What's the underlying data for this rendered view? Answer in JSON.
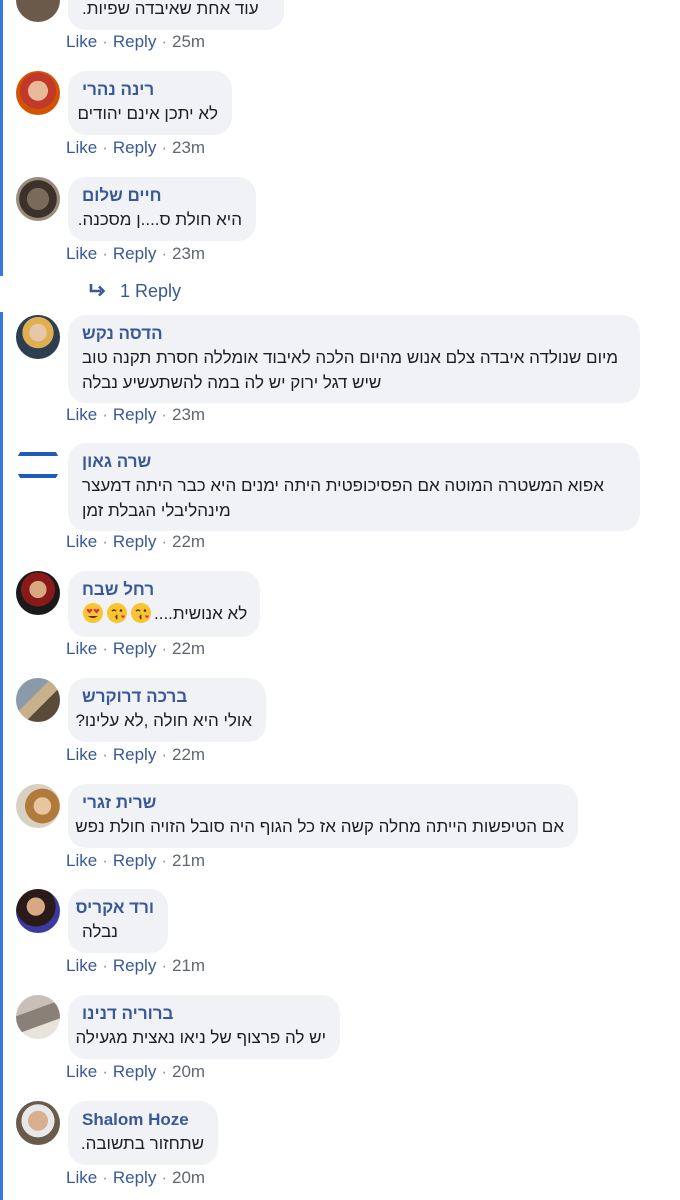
{
  "comments": [
    {
      "id": "c0",
      "author": "",
      "text": "עוד אחת שאיבדה שפיות.",
      "like": "Like",
      "reply": "Reply",
      "time": "25m"
    },
    {
      "id": "c1",
      "author": "רינה נהרי",
      "text": "לא יתכן אינם יהודים",
      "like": "Like",
      "reply": "Reply",
      "time": "23m"
    },
    {
      "id": "c2",
      "author": "חיים שלום",
      "text": "היא חולת ס....ן מסכנה.",
      "like": "Like",
      "reply": "Reply",
      "time": "23m"
    },
    {
      "id": "c3",
      "author": "הדסה נקש",
      "text": "מיום שנולדה איבדה צלם אנוש מהיום הלכה לאיבוד אומללה חסרת תקנה טוב שיש דגל ירוק יש לה במה להשתעשיע נבלה",
      "like": "Like",
      "reply": "Reply",
      "time": "23m"
    },
    {
      "id": "c4",
      "author": "שרה גאון",
      "text": "אפוא המשטרה המוטה אם הפסיכופטית היתה ימנים היא כבר היתה דמעצר מינהליבלי הגבלת זמן",
      "like": "Like",
      "reply": "Reply",
      "time": "22m"
    },
    {
      "id": "c5",
      "author": "רחל שבח",
      "text": "לא אנושית....",
      "emojis": [
        "heart-eyes",
        "kiss",
        "kiss"
      ],
      "like": "Like",
      "reply": "Reply",
      "time": "22m"
    },
    {
      "id": "c6",
      "author": "ברכה דרוקרש",
      "text": "אולי היא חולה ,לא עלינו?",
      "like": "Like",
      "reply": "Reply",
      "time": "22m"
    },
    {
      "id": "c7",
      "author": "שרית זגרי",
      "text": "אם הטיפשות הייתה מחלה קשה אז כל הגוף היה סובל הזויה חולת נפש",
      "like": "Like",
      "reply": "Reply",
      "time": "21m"
    },
    {
      "id": "c8",
      "author": "ורד אקריס",
      "text": "נבלה",
      "like": "Like",
      "reply": "Reply",
      "time": "21m"
    },
    {
      "id": "c9",
      "author": "ברוריה דנינו",
      "text": "יש לה פרצוף של ניאו נאצית מגעילה",
      "like": "Like",
      "reply": "Reply",
      "time": "20m"
    },
    {
      "id": "c10",
      "author": "Shalom Hoze",
      "text": "שתחזור בתשובה.",
      "like": "Like",
      "reply": "Reply",
      "time": "20m"
    }
  ],
  "replies_link": {
    "icon": "reply-arrow-icon",
    "label": "1 Reply"
  },
  "separator": "·",
  "colors": {
    "link": "#385898",
    "bubble": "#f0f2f5",
    "thread_line": "#3578e5",
    "meta": "#606770"
  }
}
